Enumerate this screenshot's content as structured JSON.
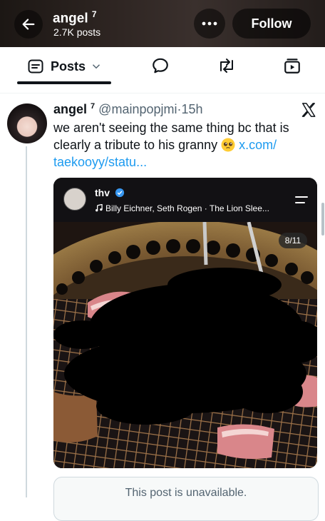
{
  "header": {
    "name": "angel",
    "name_superscript": "7",
    "post_count": "2.7K posts",
    "follow_label": "Follow",
    "back_icon": "arrow-left-icon",
    "more_icon": "more-dots-icon"
  },
  "tabs": {
    "active_label": "Posts",
    "items": [
      "posts-tab-icon",
      "replies-bubble-icon",
      "retweet-icon",
      "media-icon"
    ]
  },
  "post": {
    "display_name": "angel",
    "name_superscript": "7",
    "handle": "@mainpopjmi",
    "separator": "·",
    "time": "15h",
    "text": "we aren't seeing the same thing bc that is clearly a tribute to his granny",
    "emoji": "pleading-face-emoji",
    "link_text": "x.com/\ntaekooyy/statu...",
    "source_icon": "x-logo-icon"
  },
  "media": {
    "account_name": "thv",
    "music_text": "Billy Eichner, Seth Rogen · The Lion Slee...",
    "counter": "8/11"
  },
  "quoted": {
    "unavailable_text": "This post is unavailable."
  },
  "colors": {
    "link": "#1d9bf0",
    "text": "#0f1419",
    "secondary": "#536471"
  }
}
